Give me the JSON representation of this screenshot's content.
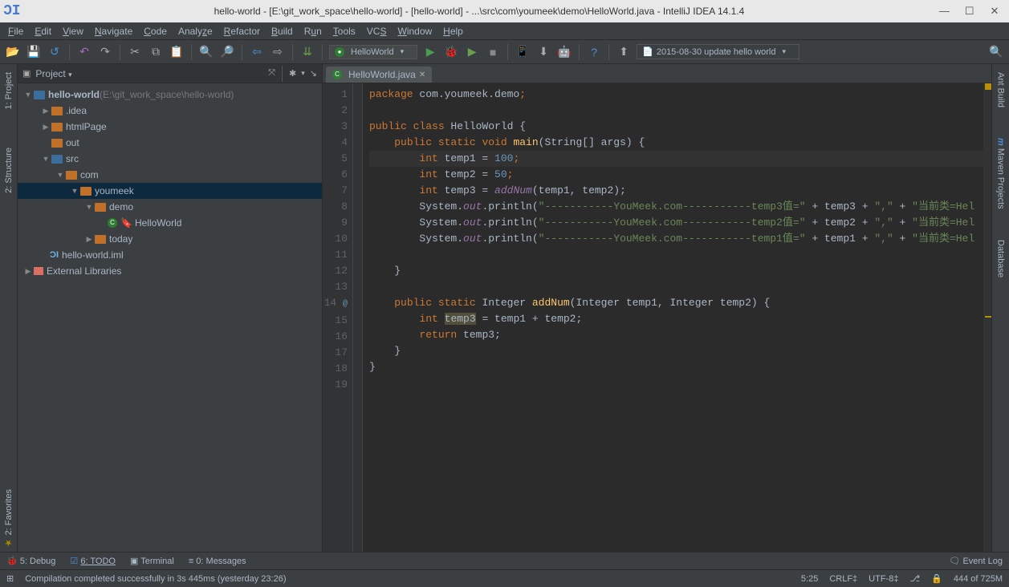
{
  "titlebar": {
    "title": "hello-world - [E:\\git_work_space\\hello-world] - [hello-world] - ...\\src\\com\\youmeek\\demo\\HelloWorld.java - IntelliJ IDEA 14.1.4"
  },
  "menu": {
    "file": "File",
    "edit": "Edit",
    "view": "View",
    "navigate": "Navigate",
    "code": "Code",
    "analyze": "Analyze",
    "refactor": "Refactor",
    "build": "Build",
    "run": "Run",
    "tools": "Tools",
    "vcs": "VCS",
    "window": "Window",
    "help": "Help"
  },
  "toolbar": {
    "runConfig": "HelloWorld",
    "vcsItem": "2015-08-30 update hello world"
  },
  "leftGutter": [
    "1: Project",
    "2: Structure",
    "2: Favorites"
  ],
  "rightGutter": [
    "Ant Build",
    "Maven Projects",
    "Database"
  ],
  "project": {
    "title": "Project",
    "root": "hello-world",
    "rootHint": "(E:\\git_work_space\\hello-world)",
    "idea": ".idea",
    "htmlPage": "htmlPage",
    "out": "out",
    "src": "src",
    "com": "com",
    "youmeek": "youmeek",
    "demo": "demo",
    "today": "today",
    "helloWorld": "HelloWorld",
    "iml": "hello-world.iml",
    "ext": "External Libraries"
  },
  "editor": {
    "tab": "HelloWorld.java",
    "lines": [
      "1",
      "2",
      "3",
      "4",
      "5",
      "6",
      "7",
      "8",
      "9",
      "10",
      "11",
      "12",
      "13",
      "14",
      "15",
      "16",
      "17",
      "18",
      "19"
    ]
  },
  "code": {
    "l1_kw": "package",
    "l1_pkg": " com.youmeek.demo",
    "l1_semi": ";",
    "l3_a": "public",
    "l3_b": " class",
    "l3_c": " HelloWorld ",
    "l3_d": "{",
    "l4_a": "public static",
    "l4_b": " void",
    "l4_c": " main",
    "l4_d": "(String[] args) ",
    "l4_e": "{",
    "l5_a": "int",
    "l5_b": " temp1 = ",
    "l5_c": "100",
    "l5_d": ";",
    "l6_a": "int",
    "l6_b": " temp2 = ",
    "l6_c": "50",
    "l6_d": ";",
    "l7_a": "int",
    "l7_b": " temp3 = ",
    "l7_c": "addNum",
    "l7_d": "(temp1, temp2);",
    "l8_a": "System.",
    "l8_b": "out",
    "l8_c": ".println(",
    "l8_d": "\"-----------YouMeek.com-----------temp3值=\"",
    "l8_e": " + temp3 + ",
    "l8_f": "\",\"",
    "l8_g": " + ",
    "l8_h": "\"当前类=Hel",
    "l9_a": "System.",
    "l9_b": "out",
    "l9_c": ".println(",
    "l9_d": "\"-----------YouMeek.com-----------temp2值=\"",
    "l9_e": " + temp2 + ",
    "l9_f": "\",\"",
    "l9_g": " + ",
    "l9_h": "\"当前类=Hel",
    "l10_a": "System.",
    "l10_b": "out",
    "l10_c": ".println(",
    "l10_d": "\"-----------YouMeek.com-----------temp1值=\"",
    "l10_e": " + temp1 + ",
    "l10_f": "\",\"",
    "l10_g": " + ",
    "l10_h": "\"当前类=Hel",
    "l12_a": "}",
    "l14_a": "public static",
    "l14_b": " Integer ",
    "l14_c": "addNum",
    "l14_d": "(Integer temp1, Integer temp2) ",
    "l14_e": "{",
    "l15_a": "int ",
    "l15_b": "temp3",
    "l15_c": " = temp1 + temp2;",
    "l16_a": "return",
    "l16_b": " temp3;",
    "l17_a": "}",
    "l18_a": "}"
  },
  "bottomTools": {
    "debug": "5: Debug",
    "todo": "6: TODO",
    "terminal": "Terminal",
    "messages": "0: Messages",
    "eventlog": "Event Log"
  },
  "status": {
    "msg": "Compilation completed successfully in 3s 445ms (yesterday 23:26)",
    "pos": "5:25",
    "lineend": "CRLF‡",
    "enc": "UTF-8‡",
    "git": "",
    "mem": "444 of 725M"
  }
}
